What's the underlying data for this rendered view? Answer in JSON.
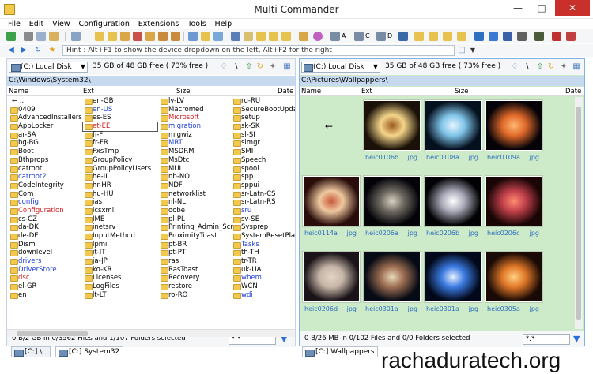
{
  "window": {
    "title": "Multi Commander"
  },
  "menu": [
    "File",
    "Edit",
    "View",
    "Configuration",
    "Extensions",
    "Tools",
    "Help"
  ],
  "toolbar_letters": [
    "A",
    "C",
    "D"
  ],
  "hint": "Hint : Alt+F1 to show the device dropdown on the left, Alt+F2 for the right",
  "left_panel": {
    "drive": "(C:) Local Disk",
    "free": "35 GB of 48 GB free ( 73% free )",
    "path": "C:\\Windows\\System32\\",
    "columns": {
      "name": "Name",
      "ext": "Ext",
      "size": "Size",
      "date": "Date"
    },
    "up": "..",
    "columns_data": [
      [
        {
          "t": "0409"
        },
        {
          "t": "AdvancedInstallers"
        },
        {
          "t": "AppLocker"
        },
        {
          "t": "ar-SA"
        },
        {
          "t": "bg-BG"
        },
        {
          "t": "Boot"
        },
        {
          "t": "Bthprops"
        },
        {
          "t": "catroot"
        },
        {
          "t": "catroot2",
          "c": "blue"
        },
        {
          "t": "CodeIntegrity"
        },
        {
          "t": "Com"
        },
        {
          "t": "config",
          "c": "blue"
        },
        {
          "t": "Configuration",
          "c": "red"
        },
        {
          "t": "cs-CZ"
        },
        {
          "t": "da-DK"
        },
        {
          "t": "de-DE"
        },
        {
          "t": "Dism"
        },
        {
          "t": "downlevel"
        },
        {
          "t": "drivers",
          "c": "blue"
        },
        {
          "t": "DriverStore",
          "c": "blue"
        },
        {
          "t": "dsc",
          "c": "red"
        },
        {
          "t": "el-GR"
        },
        {
          "t": "en"
        }
      ],
      [
        {
          "t": "en-GB"
        },
        {
          "t": "en-US",
          "c": "blue"
        },
        {
          "t": "es-ES"
        },
        {
          "t": "et-EE",
          "c": "red",
          "sel": true
        },
        {
          "t": "fi-FI"
        },
        {
          "t": "fr-FR"
        },
        {
          "t": "FxsTmp"
        },
        {
          "t": "GroupPolicy"
        },
        {
          "t": "GroupPolicyUsers"
        },
        {
          "t": "he-IL"
        },
        {
          "t": "hr-HR"
        },
        {
          "t": "hu-HU"
        },
        {
          "t": "ias"
        },
        {
          "t": "icsxml"
        },
        {
          "t": "IME"
        },
        {
          "t": "inetsrv"
        },
        {
          "t": "InputMethod"
        },
        {
          "t": "lpmi"
        },
        {
          "t": "it-IT"
        },
        {
          "t": "ja-JP"
        },
        {
          "t": "ko-KR"
        },
        {
          "t": "Licenses"
        },
        {
          "t": "LogFiles"
        },
        {
          "t": "lt-LT"
        }
      ],
      [
        {
          "t": "lv-LV"
        },
        {
          "t": "Macromed"
        },
        {
          "t": "Microsoft",
          "c": "red"
        },
        {
          "t": "migration",
          "c": "blue"
        },
        {
          "t": "migwiz"
        },
        {
          "t": "MRT",
          "c": "blue"
        },
        {
          "t": "MSDRM"
        },
        {
          "t": "MsDtc"
        },
        {
          "t": "MUI"
        },
        {
          "t": "nb-NO"
        },
        {
          "t": "NDF"
        },
        {
          "t": "networklist"
        },
        {
          "t": "nl-NL"
        },
        {
          "t": "oobe"
        },
        {
          "t": "pl-PL"
        },
        {
          "t": "Printing_Admin_Scri..."
        },
        {
          "t": "ProximityToast"
        },
        {
          "t": "pt-BR"
        },
        {
          "t": "pt-PT"
        },
        {
          "t": "ras"
        },
        {
          "t": "RasToast"
        },
        {
          "t": "Recovery"
        },
        {
          "t": "restore"
        },
        {
          "t": "ro-RO"
        }
      ],
      [
        {
          "t": "ru-RU"
        },
        {
          "t": "SecureBootUpdate"
        },
        {
          "t": "setup"
        },
        {
          "t": "sk-SK"
        },
        {
          "t": "sl-SI"
        },
        {
          "t": "slmgr"
        },
        {
          "t": "SMI"
        },
        {
          "t": "Speech"
        },
        {
          "t": "spool"
        },
        {
          "t": "spp"
        },
        {
          "t": "sppui"
        },
        {
          "t": "sr-Latn-CS"
        },
        {
          "t": "sr-Latn-RS"
        },
        {
          "t": "sru",
          "c": "blue"
        },
        {
          "t": "sv-SE"
        },
        {
          "t": "Sysprep"
        },
        {
          "t": "SystemResetPlatfor"
        },
        {
          "t": "Tasks",
          "c": "blue"
        },
        {
          "t": "th-TH"
        },
        {
          "t": "tr-TR"
        },
        {
          "t": "uk-UA"
        },
        {
          "t": "wbem",
          "c": "blue"
        },
        {
          "t": "WCN"
        },
        {
          "t": "wdi",
          "c": "blue"
        }
      ]
    ],
    "status": "0 B/2 GB in 0/3562 Files and 1/107 Folders selected",
    "filter": "*.*"
  },
  "right_panel": {
    "drive": "(C:) Local Disk",
    "free": "35 GB of 48 GB free ( 73% free )",
    "path": "C:\\Pictures\\Wallpappers\\",
    "columns": {
      "name": "Name",
      "ext": "Ext",
      "size": "Size",
      "date": "Date"
    },
    "up": "..",
    "thumbnails": [
      {
        "name": "heic0106b",
        "ext": "jpg",
        "colors": [
          "#1a1208",
          "#f5d58a",
          "#9a5a20"
        ]
      },
      {
        "name": "heic0108a",
        "ext": "jpg",
        "colors": [
          "#05101f",
          "#7fc4e8",
          "#e8f4ff"
        ]
      },
      {
        "name": "heic0109a",
        "ext": "jpg",
        "colors": [
          "#050308",
          "#e0692a",
          "#ffb870"
        ]
      },
      {
        "name": "heic0114a",
        "ext": "jpg",
        "colors": [
          "#2a0d0a",
          "#f0c9a0",
          "#c85a3a"
        ]
      },
      {
        "name": "heic0206a",
        "ext": "jpg",
        "colors": [
          "#030308",
          "#6f6a62",
          "#d8d0c0"
        ]
      },
      {
        "name": "heic0206b",
        "ext": "jpg",
        "colors": [
          "#020205",
          "#a9a9b8",
          "#ffffff"
        ]
      },
      {
        "name": "heic0206c",
        "ext": "jpg",
        "colors": [
          "#1a0505",
          "#c0404a",
          "#ff8a70"
        ]
      },
      {
        "name": "heic0206d",
        "ext": "jpg",
        "colors": [
          "#1a1418",
          "#c7b6a8",
          "#e3d3c6"
        ]
      },
      {
        "name": "heic0301a",
        "ext": "jpg",
        "colors": [
          "#050a14",
          "#9d6d52",
          "#e8d8b8"
        ]
      },
      {
        "name": "heic0301a",
        "ext": "jpg",
        "colors": [
          "#02081a",
          "#3a7ae0",
          "#e8f0ff"
        ]
      },
      {
        "name": "heic0305a",
        "ext": "jpg",
        "colors": [
          "#1a0a05",
          "#e07828",
          "#ffd080"
        ]
      }
    ],
    "status": "0 B/26 MB in 0/102 Files and 0/0 Folders selected",
    "filter": "*.*"
  },
  "tabs_left": [
    "[C:] \\",
    "[C:] System32"
  ],
  "tabs_right": [
    "[C:] Wallpappers"
  ],
  "watermark": "rachaduratech.org"
}
